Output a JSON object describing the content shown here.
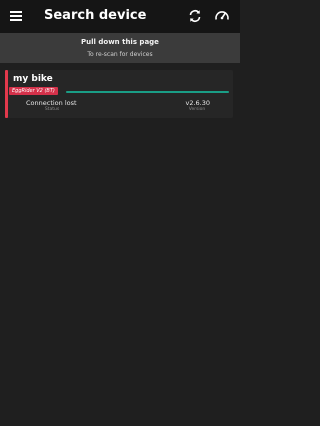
{
  "appbar": {
    "title": "Search device",
    "menu_icon": "menu-icon",
    "actions": [
      {
        "icon": "refresh-icon"
      },
      {
        "icon": "gauge-icon"
      }
    ]
  },
  "hint": {
    "line1": "Pull down this page",
    "line2": "To re-scan for devices"
  },
  "devices": [
    {
      "name": "my bike",
      "type": "EggRider V2 (BT)",
      "signal_fraction": 1.0,
      "status": "Connection lost",
      "status_caption": "Status",
      "version": "v2.6.30",
      "version_caption": "Version"
    }
  ],
  "colors": {
    "accent": "#e2394c",
    "signal": "#1a9e86",
    "background": "#1f1f1f",
    "appbar": "#151515"
  }
}
